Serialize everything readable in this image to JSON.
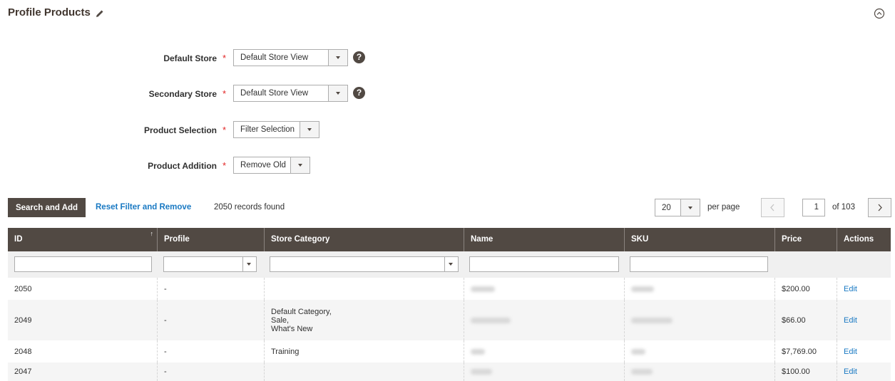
{
  "header": {
    "title": "Profile Products",
    "edit_icon": "pencil-icon",
    "collapse_icon": "chevron-up-circle-icon"
  },
  "form": {
    "required_mark": "*",
    "help_glyph": "?",
    "default_store": {
      "label": "Default Store",
      "value": "Default Store View"
    },
    "secondary_store": {
      "label": "Secondary Store",
      "value": "Default Store View"
    },
    "product_selection": {
      "label": "Product Selection",
      "value": "Filter Selection"
    },
    "product_addition": {
      "label": "Product Addition",
      "value": "Remove Old"
    }
  },
  "toolbar": {
    "search_add_label": "Search and Add",
    "reset_label": "Reset Filter and Remove",
    "records_found": "2050 records found",
    "per_page_value": "20",
    "per_page_label": "per page",
    "page_current": "1",
    "page_of": "of 103"
  },
  "grid": {
    "columns": [
      "ID",
      "Profile",
      "Store Category",
      "Name",
      "SKU",
      "Price",
      "Actions"
    ],
    "sort_glyph": "↑",
    "rows": [
      {
        "id": "2050",
        "profile": "-",
        "category": "",
        "price": "$200.00",
        "action": "Edit"
      },
      {
        "id": "2049",
        "profile": "-",
        "category_lines": [
          "Default Category,",
          "Sale,",
          "What's New"
        ],
        "price": "$66.00",
        "action": "Edit"
      },
      {
        "id": "2048",
        "profile": "-",
        "category": "Training",
        "price": "$7,769.00",
        "action": "Edit"
      },
      {
        "id": "2047",
        "profile": "-",
        "category": "",
        "price": "$100.00",
        "action": "Edit"
      }
    ]
  },
  "colors": {
    "header_bg": "#514943",
    "link": "#1979c3",
    "required": "#e22626"
  }
}
